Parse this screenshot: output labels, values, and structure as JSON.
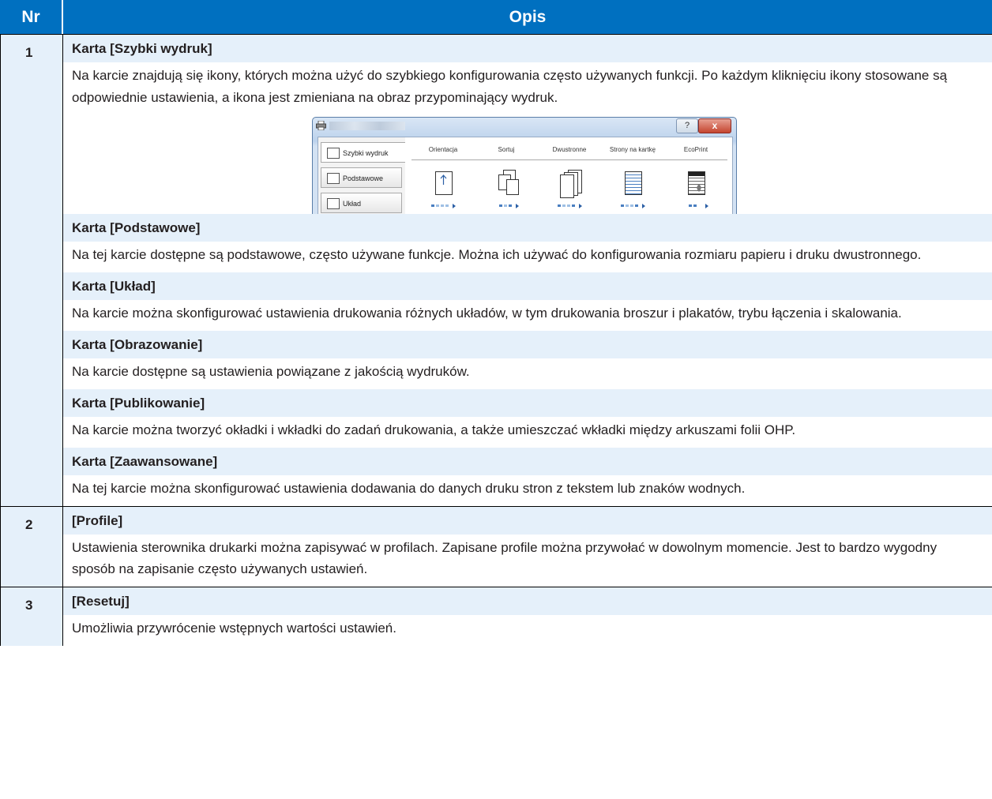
{
  "header": {
    "nr": "Nr",
    "opis": "Opis"
  },
  "rows": [
    {
      "nr": "1",
      "sections": [
        {
          "title": "Karta [Szybki wydruk]",
          "text": "Na karcie znajdują się ikony, których można użyć do szybkiego konfigurowania często używanych funkcji. Po każdym kliknięciu ikony stosowane są odpowiednie ustawienia, a ikona jest zmieniana na obraz przypominający wydruk."
        },
        {
          "title": "Karta [Podstawowe]",
          "text": "Na tej karcie dostępne są podstawowe, często używane funkcje. Można ich używać do konfigurowania rozmiaru papieru i druku dwustronnego."
        },
        {
          "title": "Karta [Układ]",
          "text": "Na karcie można skonfigurować ustawienia drukowania różnych układów, w tym drukowania broszur i plakatów, trybu łączenia i skalowania."
        },
        {
          "title": "Karta [Obrazowanie]",
          "text": "Na karcie dostępne są ustawienia powiązane z jakością wydruków."
        },
        {
          "title": "Karta [Publikowanie]",
          "text": "Na karcie można tworzyć okładki i wkładki do zadań drukowania, a także umieszczać wkładki między arkuszami folii OHP."
        },
        {
          "title": "Karta [Zaawansowane]",
          "text": "Na tej karcie można skonfigurować ustawienia dodawania do danych druku stron z tekstem lub znaków wodnych."
        }
      ]
    },
    {
      "nr": "2",
      "title": "[Profile]",
      "text": "Ustawienia sterownika drukarki można zapisywać w profilach. Zapisane profile można przywołać w dowolnym momencie. Jest to bardzo wygodny sposób na zapisanie często używanych ustawień."
    },
    {
      "nr": "3",
      "title": "[Resetuj]",
      "text": "Umożliwia przywrócenie wstępnych wartości ustawień."
    }
  ],
  "screenshot": {
    "help_label": "?",
    "close_label": "x",
    "tabs": [
      "Szybki wydruk",
      "Podstawowe",
      "Układ"
    ],
    "columns": [
      "Orientacja",
      "Sortuj",
      "Dwustronne",
      "Strony na kartkę",
      "EcoPrint"
    ]
  }
}
